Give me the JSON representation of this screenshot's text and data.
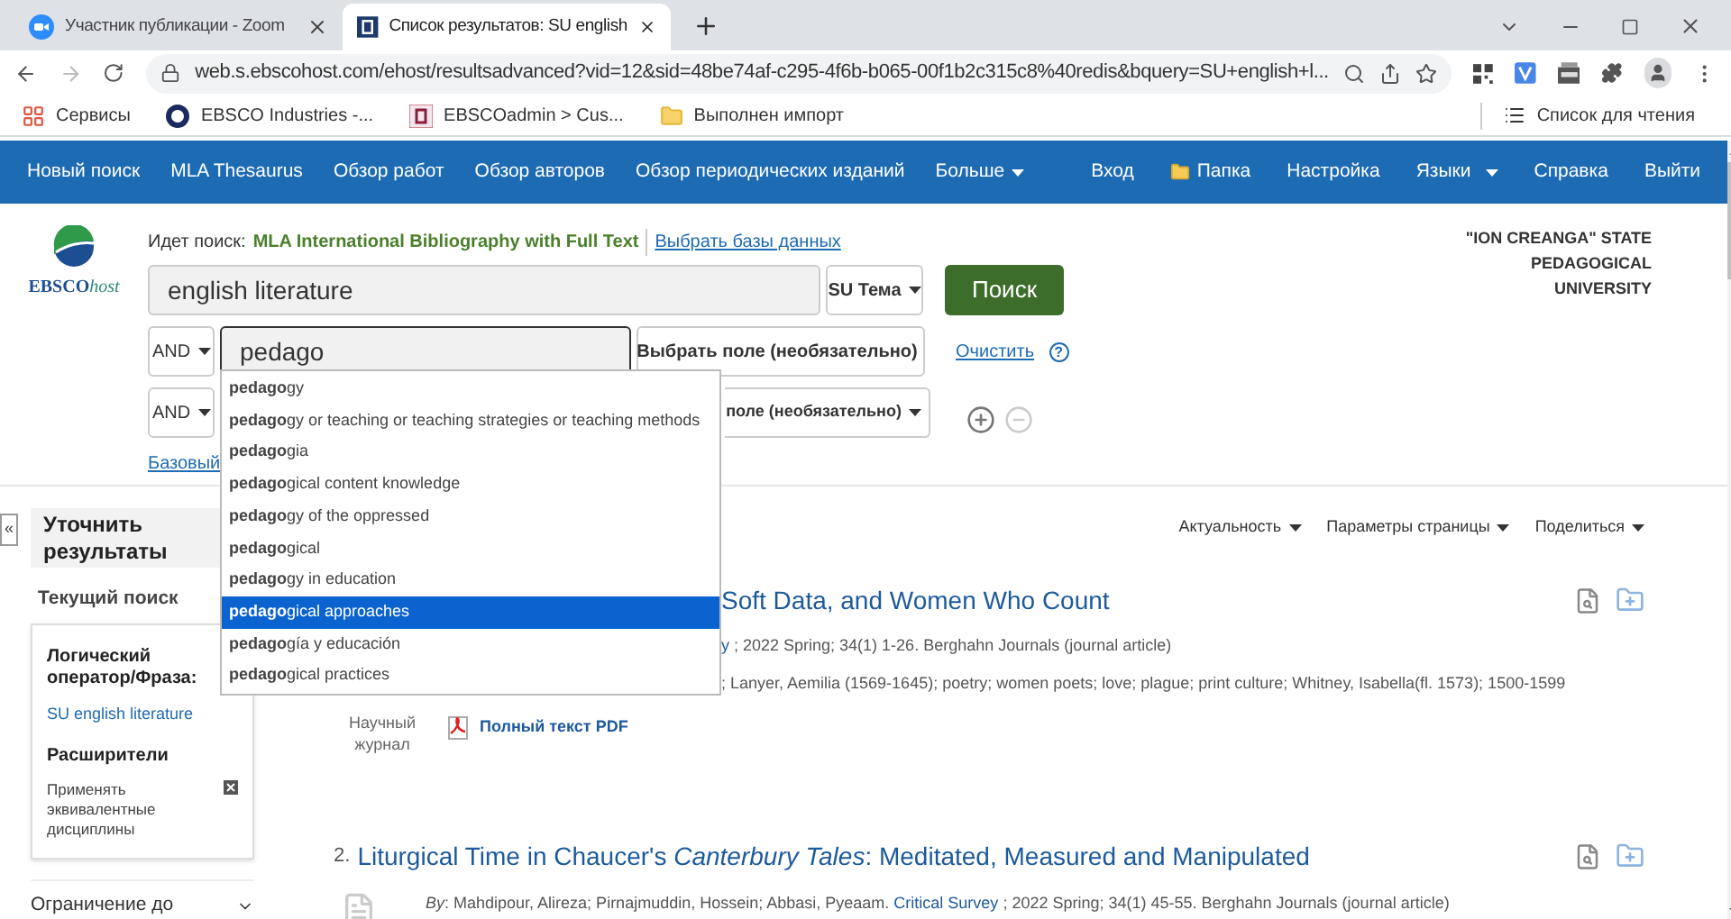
{
  "browser": {
    "tabs": [
      {
        "title": "Участник публикации - Zoom",
        "kind": "zoom",
        "selected": false
      },
      {
        "title": "Список результатов: SU english",
        "kind": "ebsco",
        "selected": true
      }
    ],
    "url": "web.s.ebscohost.com/ehost/resultsadvanced?vid=12&sid=48be74af-c295-4f6b-b065-00f1b2c315c8%40redis&bquery=SU+english+l...",
    "bookmarks": [
      {
        "label": "Сервисы",
        "kind": "apps"
      },
      {
        "label": "EBSCO Industries -...",
        "kind": "ring"
      },
      {
        "label": "EBSCOadmin > Cus...",
        "kind": "ebsco"
      },
      {
        "label": "Выполнен импорт",
        "kind": "folder"
      }
    ],
    "reading_list": "Список для чтения"
  },
  "nav": {
    "left": [
      {
        "label": "Новый поиск",
        "dropdown": false
      },
      {
        "label": "MLA Thesaurus",
        "dropdown": false
      },
      {
        "label": "Обзор работ",
        "dropdown": false
      },
      {
        "label": "Обзор авторов",
        "dropdown": false
      },
      {
        "label": "Обзор периодических изданий",
        "dropdown": false
      },
      {
        "label": "Больше",
        "dropdown": true
      }
    ],
    "right": [
      {
        "label": "Вход",
        "kind": "link"
      },
      {
        "label": "Папка",
        "kind": "folder"
      },
      {
        "label": "Настройка",
        "kind": "link"
      },
      {
        "label": "Языки",
        "kind": "dropdown"
      },
      {
        "label": "Справка",
        "kind": "link"
      },
      {
        "label": "Выйти",
        "kind": "link"
      }
    ]
  },
  "logo": {
    "brand": "EBSCO",
    "suffix": "host"
  },
  "search": {
    "searching_label": "Идет поиск:",
    "database": "MLA International Bibliography with Full Text",
    "choose_databases": "Выбрать базы данных",
    "row_1": {
      "value": "english literature",
      "field": "SU Тема"
    },
    "search_button": "Поиск",
    "row_2": {
      "operator": "AND",
      "value": "pedago",
      "field": "Выбрать поле (необязательно)"
    },
    "clear": "Очистить",
    "help": "?",
    "row_3": {
      "operator": "AND",
      "field": "поле (необязательно)"
    },
    "basic_link": "Базовый"
  },
  "institution": [
    "\"ION CREANGA\" STATE",
    "PEDAGOGICAL",
    "UNIVERSITY"
  ],
  "autocomplete": [
    {
      "text": "**pedago**gy",
      "selected": false
    },
    {
      "text": "**pedago**gy or teaching or teaching strategies or teaching methods",
      "selected": false
    },
    {
      "text": "**pedago**gia",
      "selected": false
    },
    {
      "text": "**pedago**gical content knowledge",
      "selected": false
    },
    {
      "text": "**pedago**gy of the oppressed",
      "selected": false
    },
    {
      "text": "**pedago**gical",
      "selected": false
    },
    {
      "text": "**pedago**gy in education",
      "selected": false
    },
    {
      "text": "**pedago**gical approaches",
      "selected": true
    },
    {
      "text": "**pedago**gía y educación",
      "selected": false
    },
    {
      "text": "**pedago**gical practices",
      "selected": false
    }
  ],
  "sidebar": {
    "collapse": "«",
    "title": "Уточнить результаты",
    "current_search": "Текущий поиск",
    "operator_heading": "Логический оператор/Фраза:",
    "operator_value": "SU english literature",
    "expanders_heading": "Расширители",
    "expander": "Применять эквивалентные дисциплины",
    "limit": "Ограничение до"
  },
  "toolbar": [
    "Актуальность",
    "Параметры страницы",
    "Поделиться"
  ],
  "results": [
    {
      "title": "Soft Data, and Women Who Count",
      "journal": "y",
      "meta": " ; 2022 Spring; 34(1) 1-26. Berghahn Journals (journal article)",
      "subjects": "; Lanyer, Aemilia (1569-1645); poetry; women poets; love; plague; print culture; Whitney, Isabella(fl. 1573); 1500-1599",
      "type": "Научный журнал",
      "pdf": "Полный текст PDF"
    },
    {
      "number": "2.",
      "title": "Liturgical Time in Chaucer's *Canterbury Tales*: Meditated, Measured and Manipulated",
      "authors": "*By*: Mahdipour, Alireza; Pirnajmuddin, Hossein; Abbasi, Pyeaam.",
      "journal": "Critical Survey",
      "meta": " ; 2022 Spring; 34(1) 45-55. Berghahn Journals (journal article)"
    }
  ]
}
